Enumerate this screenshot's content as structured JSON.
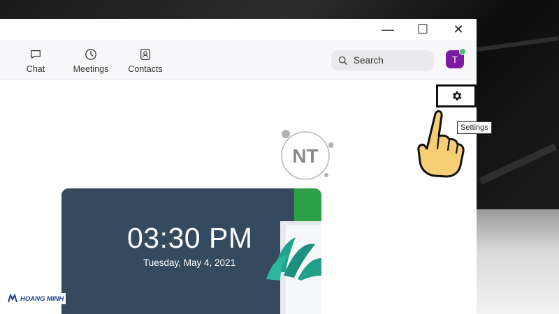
{
  "window": {
    "controls": {
      "minimize": "—",
      "maximize": "☐",
      "close": "✕"
    }
  },
  "toolbar": {
    "nav": [
      {
        "label": "Chat",
        "icon": "chat-icon"
      },
      {
        "label": "Meetings",
        "icon": "clock-icon"
      },
      {
        "label": "Contacts",
        "icon": "contacts-icon"
      }
    ],
    "search": {
      "label": "Search",
      "icon": "search-icon"
    },
    "avatar": {
      "initial": "T",
      "color": "#7d1aa3",
      "status_color": "#45c46a"
    }
  },
  "settings": {
    "icon": "gear-icon",
    "tooltip": "Settings"
  },
  "logo": {
    "text": "NT"
  },
  "clock": {
    "time": "03:30 PM",
    "date": "Tuesday, May 4, 2021",
    "card_color": "#35495f"
  },
  "watermark": {
    "text": "HOANG MINH"
  }
}
